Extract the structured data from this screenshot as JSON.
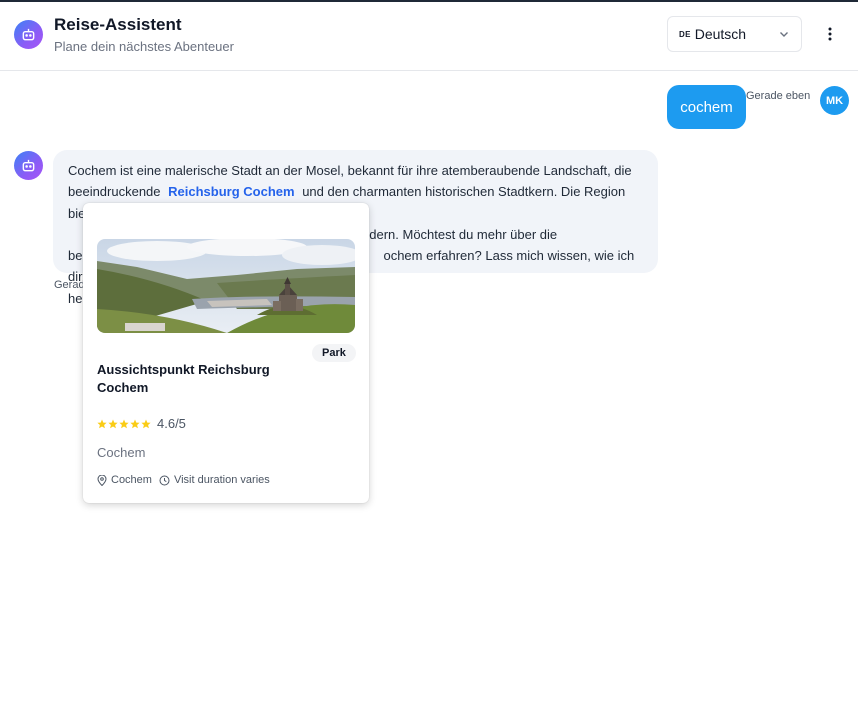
{
  "header": {
    "title": "Reise-Assistent",
    "subtitle": "Plane dein nächstes Abenteuer",
    "bot_icon": "robot-icon",
    "language": {
      "code": "DE",
      "label": "Deutsch"
    },
    "menu_icon": "more-vertical-icon"
  },
  "messages": [
    {
      "role": "user",
      "text": "cochem",
      "time": "Gerade eben",
      "avatar_initials": "MK"
    },
    {
      "role": "assistant",
      "text_before": "Cochem ist eine malerische Stadt an der Mosel, bekannt für ihre atemberaubende Landschaft, die beeindruckende",
      "entity": "Reichsburg Cochem",
      "text_after": "und den charmanten historischen Stadtkern. Die Region bietet au",
      "line3_tail": "d zum Wandern. Möchtest du mehr über die",
      "line4_start": "be",
      "line4_tail": "ochem erfahren? Lass mich wissen, wie ich dir",
      "line5_start": "he",
      "time": "Gerad"
    }
  ],
  "place_card": {
    "image_alt": "castle-landscape-photo",
    "type": "Park",
    "name": "Aussichtspunkt Reichsburg Cochem",
    "rating": 4.6,
    "rating_text": "4.6/5",
    "stars": 5,
    "city": "Cochem",
    "location": "Cochem",
    "duration": "Visit duration varies"
  },
  "colors": {
    "accent": "#1d9bf0",
    "link": "#2563eb",
    "bot_bubble": "#f1f4f9",
    "star": "#facc15"
  }
}
